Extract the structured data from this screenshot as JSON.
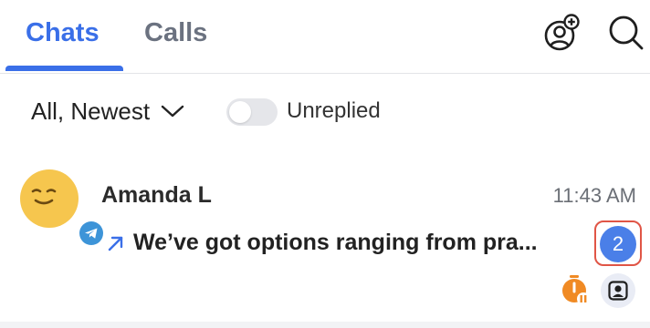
{
  "tabs": [
    {
      "label": "Chats",
      "active": true
    },
    {
      "label": "Calls",
      "active": false
    }
  ],
  "header_icons": {
    "new_contact": "add-contact-icon",
    "search": "search-icon"
  },
  "filter": {
    "sort_label": "All, Newest",
    "unreplied_label": "Unreplied",
    "unreplied_enabled": false
  },
  "chats": [
    {
      "name": "Amanda L",
      "time": "11:43 AM",
      "message": "We’ve got options ranging from pra...",
      "direction": "outgoing",
      "unread_count": "2",
      "platform": "telegram",
      "avatar": "smiling-face"
    }
  ],
  "colors": {
    "accent": "#3a6fe8",
    "badge": "#4a7fe8",
    "highlight": "#e05546",
    "avatar_bg": "#f6c64e",
    "timer": "#f08a24",
    "telegram": "#3d94d8"
  }
}
